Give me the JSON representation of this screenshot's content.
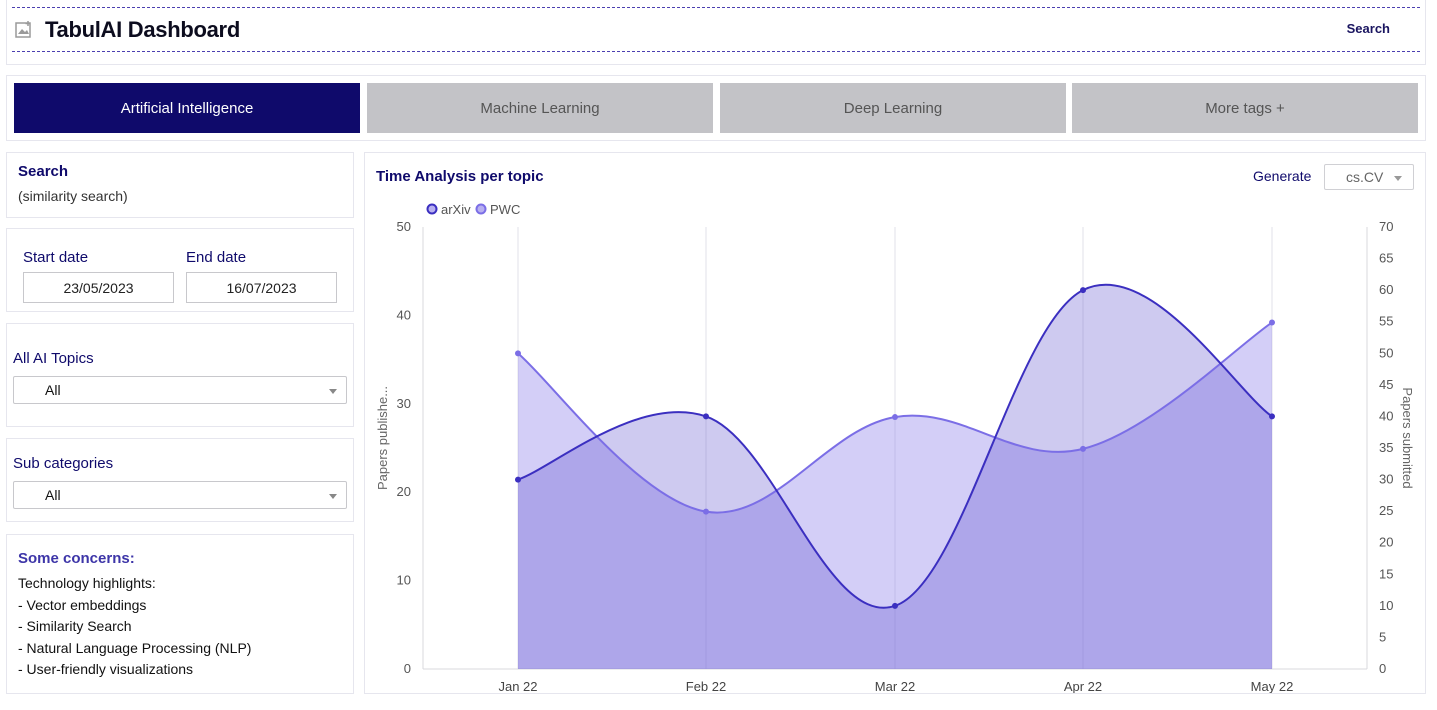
{
  "header": {
    "title": "TabulAI Dashboard",
    "search_label": "Search",
    "icon": "image-icon"
  },
  "tabs": [
    {
      "label": "Artificial Intelligence",
      "active": true
    },
    {
      "label": "Machine Learning",
      "active": false
    },
    {
      "label": "Deep Learning",
      "active": false
    },
    {
      "label": "More tags +",
      "active": false
    }
  ],
  "sidebar": {
    "search": {
      "title": "Search",
      "subtitle": "(similarity search)"
    },
    "dates": {
      "start_label": "Start date",
      "start_value": "23/05/2023",
      "end_label": "End date",
      "end_value": "16/07/2023"
    },
    "topics": {
      "label": "All AI Topics",
      "selected": "All"
    },
    "subcategories": {
      "label": "Sub categories",
      "selected": "All"
    },
    "concerns": {
      "title": "Some concerns:",
      "lines": [
        "Technology highlights:",
        "- Vector embeddings",
        "- Similarity Search",
        "- Natural Language Processing (NLP)",
        "- User-friendly visualizations"
      ]
    }
  },
  "chart_panel": {
    "title": "Time Analysis per topic",
    "generate_label": "Generate",
    "generate_selected": "cs.CV"
  },
  "colors": {
    "primary": "#0f0a6b",
    "tab_inactive": "#c3c3c7",
    "arxiv": "#3b2fc0",
    "pwc": "#7b6ee6"
  },
  "chart_data": {
    "type": "area",
    "categories": [
      "Jan 22",
      "Feb 22",
      "Mar 22",
      "Apr 22",
      "May 22"
    ],
    "ylabel_left": "Papers publishe...",
    "ylabel_right": "Papers submitted",
    "ylim_left": [
      0,
      50
    ],
    "ylim_right": [
      0,
      70
    ],
    "yticks_left": [
      0,
      10,
      20,
      30,
      40,
      50
    ],
    "yticks_right": [
      0,
      5,
      10,
      15,
      20,
      25,
      30,
      35,
      40,
      45,
      50,
      55,
      60,
      65,
      70
    ],
    "legend_position": "top-left",
    "grid": "vertical",
    "series": [
      {
        "name": "arXiv",
        "axis": "right",
        "values": [
          30,
          40,
          10,
          60,
          40
        ]
      },
      {
        "name": "PWC",
        "axis": "left",
        "values": [
          35.7,
          17.8,
          28.5,
          24.9,
          39.2
        ]
      }
    ]
  }
}
